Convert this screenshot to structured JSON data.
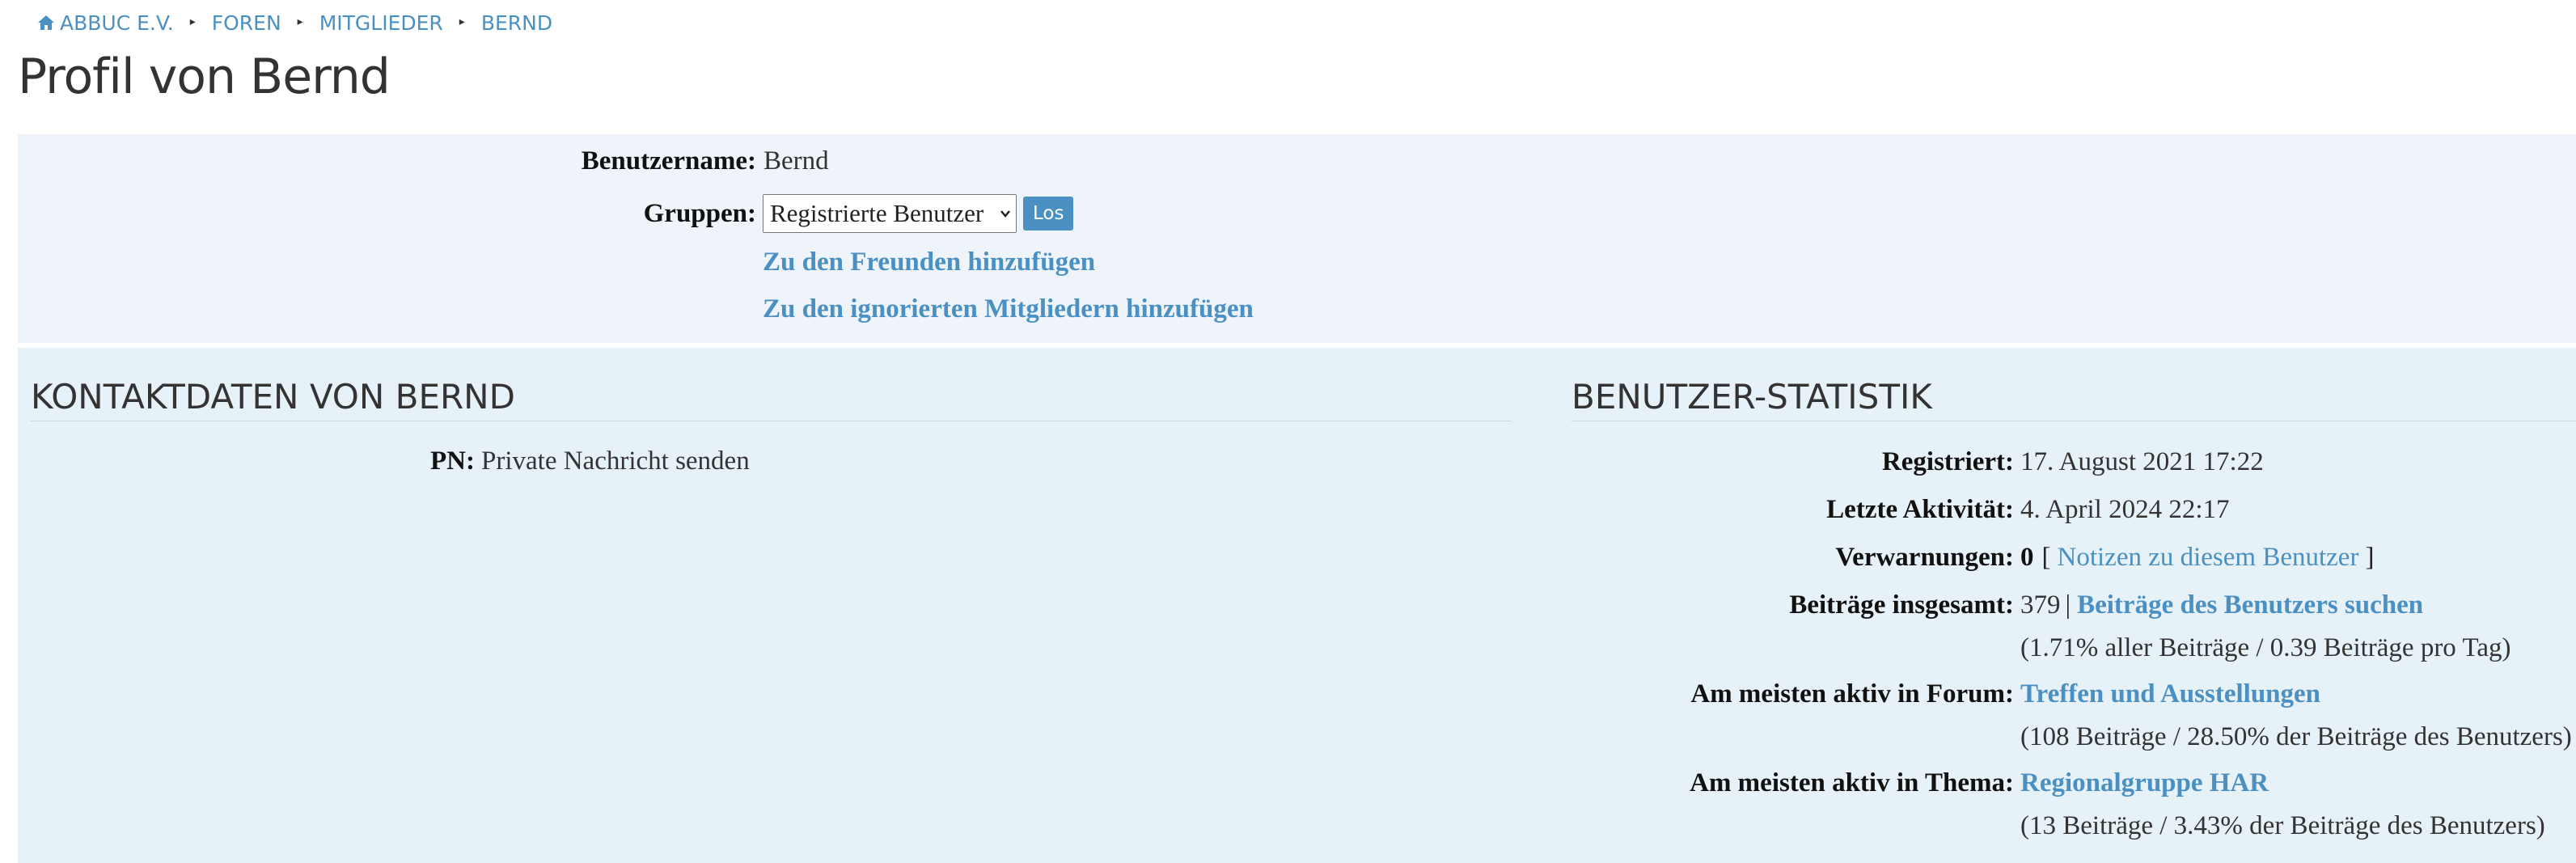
{
  "breadcrumb": [
    "ABBUC E.V.",
    "FOREN",
    "MITGLIEDER",
    "BERND"
  ],
  "page_title": "Profil von Bernd",
  "profile": {
    "username_label": "Benutzername:",
    "username": "Bernd",
    "groups_label": "Gruppen:",
    "groups_selected": "Registrierte Benutzer",
    "go_button": "Los",
    "add_friend": "Zu den Freunden hinzufügen",
    "add_ignore": "Zu den ignorierten Mitgliedern hinzufügen"
  },
  "contact": {
    "title": "KONTAKTDATEN VON BERND",
    "pn_label": "PN:",
    "pn_link": "Private Nachricht senden"
  },
  "stats": {
    "title": "BENUTZER-STATISTIK",
    "registered_label": "Registriert:",
    "registered": "17. August 2021 17:22",
    "last_activity_label": "Letzte Aktivität:",
    "last_activity": "4. April 2024 22:17",
    "warnings_label": "Verwarnungen:",
    "warnings": "0",
    "warnings_open": "[",
    "warnings_link": "Notizen zu diesem Benutzer",
    "warnings_close": "]",
    "posts_label": "Beiträge insgesamt:",
    "posts": "379",
    "posts_sep": "|",
    "posts_link": "Beiträge des Benutzers suchen",
    "posts_sub": "(1.71% aller Beiträge / 0.39 Beiträge pro Tag)",
    "forum_label": "Am meisten aktiv in Forum:",
    "forum_link": "Treffen und Ausstellungen",
    "forum_sub": "(108 Beiträge / 28.50% der Beiträge des Benutzers)",
    "topic_label": "Am meisten aktiv in Thema:",
    "topic_link": "Regionalgruppe HAR",
    "topic_sub": "(13 Beiträge / 3.43% der Beiträge des Benutzers)"
  }
}
